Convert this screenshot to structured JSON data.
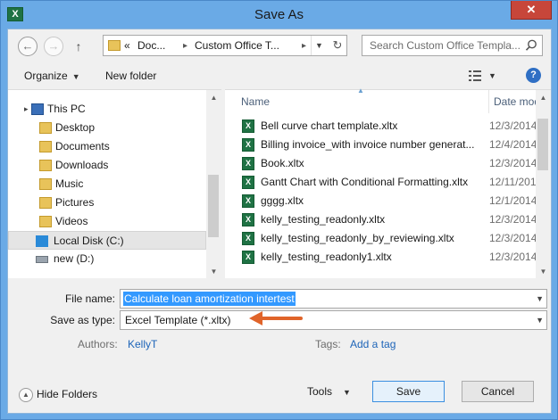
{
  "window": {
    "title": "Save As",
    "app_icon": "X",
    "close": "✕"
  },
  "nav": {
    "back": "←",
    "forward": "→",
    "up": "↑"
  },
  "address": {
    "prefix": "«",
    "crumbs": [
      "Doc...",
      "Custom Office T..."
    ],
    "separator": "▸",
    "refresh": "↻"
  },
  "search": {
    "placeholder": "Search Custom Office Templa..."
  },
  "toolbar": {
    "organize": "Organize",
    "new_folder": "New folder",
    "help": "?"
  },
  "sidebar": {
    "items": [
      {
        "label": "This PC",
        "icon": "computer-icon",
        "expand": "▸"
      },
      {
        "label": "Desktop",
        "icon": "folder-icon"
      },
      {
        "label": "Documents",
        "icon": "folder-icon"
      },
      {
        "label": "Downloads",
        "icon": "folder-icon"
      },
      {
        "label": "Music",
        "icon": "folder-icon"
      },
      {
        "label": "Pictures",
        "icon": "folder-icon"
      },
      {
        "label": "Videos",
        "icon": "folder-icon"
      },
      {
        "label": "Local Disk (C:)",
        "icon": "windows-drive-icon"
      },
      {
        "label": "new (D:)",
        "icon": "drive-icon"
      }
    ]
  },
  "files": {
    "columns": {
      "name": "Name",
      "date": "Date modi"
    },
    "rows": [
      {
        "name": "Bell curve chart template.xltx",
        "date": "12/3/2014"
      },
      {
        "name": "Billing invoice_with invoice number generat...",
        "date": "12/4/2014"
      },
      {
        "name": "Book.xltx",
        "date": "12/3/2014"
      },
      {
        "name": "Gantt Chart with Conditional Formatting.xltx",
        "date": "12/11/2014"
      },
      {
        "name": "gggg.xltx",
        "date": "12/1/2014"
      },
      {
        "name": "kelly_testing_readonly.xltx",
        "date": "12/3/2014"
      },
      {
        "name": "kelly_testing_readonly_by_reviewing.xltx",
        "date": "12/3/2014"
      },
      {
        "name": "kelly_testing_readonly1.xltx",
        "date": "12/3/2014"
      }
    ]
  },
  "form": {
    "file_name_label": "File name:",
    "file_name_value": "Calculate loan amortization intertest",
    "save_type_label": "Save as type:",
    "save_type_value": "Excel Template (*.xltx)",
    "authors_label": "Authors:",
    "authors_value": "KellyT",
    "tags_label": "Tags:",
    "tags_value": "Add a tag"
  },
  "footer": {
    "hide_folders": "Hide Folders",
    "tools": "Tools",
    "save": "Save",
    "cancel": "Cancel"
  },
  "colors": {
    "accent": "#3399ff",
    "annotation_arrow": "#e0642a",
    "link": "#1d64b8"
  }
}
